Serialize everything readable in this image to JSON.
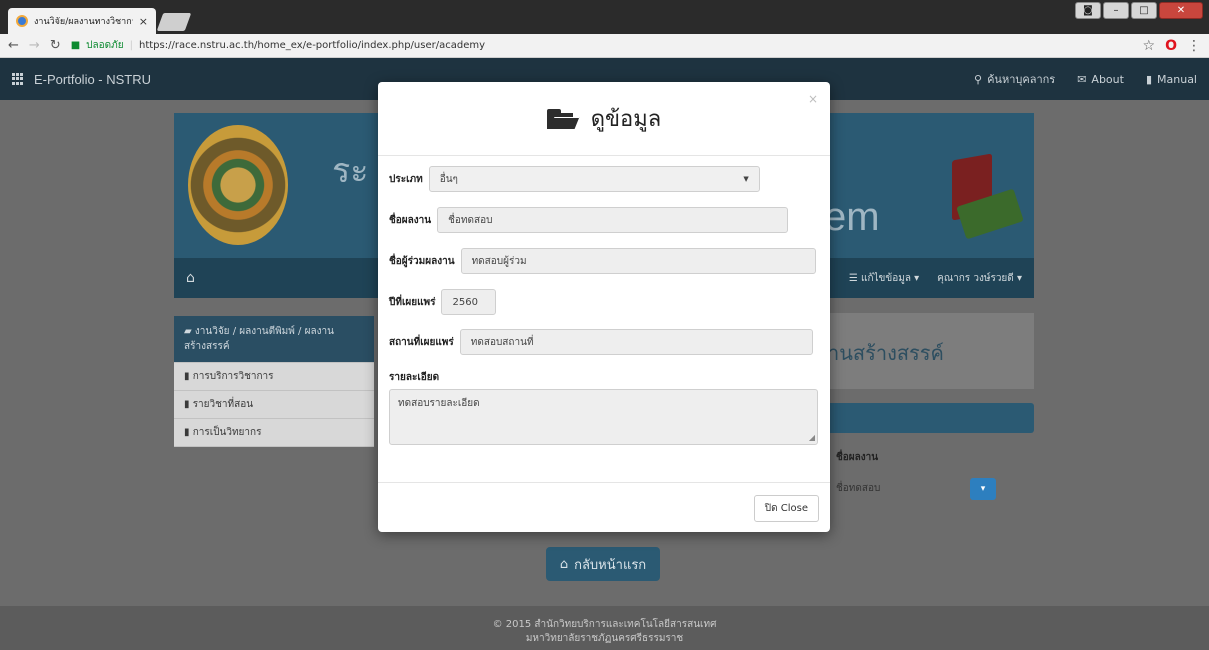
{
  "browser": {
    "tab_title": "งานวิจัย/ผลงานทางวิชาการ | ",
    "tab_close": "×",
    "secure_label": "ปลอดภัย",
    "url": "https://race.nstru.ac.th/home_ex/e-portfolio/index.php/user/academy"
  },
  "navbar": {
    "brand": "E-Portfolio - NSTRU",
    "links": [
      {
        "label": "ค้นหาบุคลากร",
        "icon": "search-icon"
      },
      {
        "label": "About",
        "icon": "mail-icon"
      },
      {
        "label": "Manual",
        "icon": "file-icon"
      }
    ]
  },
  "banner": {
    "title_part": "ระ",
    "title_part2": "em"
  },
  "menubar": {
    "edit_label": "แก้ไขข้อมูล",
    "user_label": "คุณากร วงษ์รวยดี"
  },
  "sidebar": {
    "items": [
      "งานวิจัย / ผลงานตีพิมพ์ / ผลงานสร้างสรรค์",
      "การบริการวิชาการ",
      "รายวิชาที่สอน",
      "การเป็นวิทยากร"
    ]
  },
  "content": {
    "heading_part": "านสร้างสรรค์",
    "col_header": "ชื่อผลงาน",
    "row_value": "ชื่อทดสอบ"
  },
  "home_button": "กลับหน้าแรก",
  "footer": {
    "line1": "© 2015 สำนักวิทยบริการและเทคโนโลยีสารสนเทศ",
    "line2": "มหาวิทยาลัยราชภัฏนครศรีธรรมราช"
  },
  "modal": {
    "title": "ดูข้อมูล",
    "close_x": "×",
    "type_label": "ประเภท",
    "type_value": "อื่นๆ",
    "work_name_label": "ชื่อผลงาน",
    "work_name_value": "ชื่อทดสอบ",
    "coauthor_label": "ชื่อผู้ร่วมผลงาน",
    "coauthor_value": "ทดสอบผู้ร่วม",
    "year_label": "ปีที่เผยแพร่",
    "year_value": "2560",
    "place_label": "สถานที่เผยแพร่",
    "place_value": "ทดสอบสถานที่",
    "detail_label": "รายละเอียด",
    "detail_value": "ทดสอบรายละเอียด",
    "close_button": "ปิด Close"
  }
}
